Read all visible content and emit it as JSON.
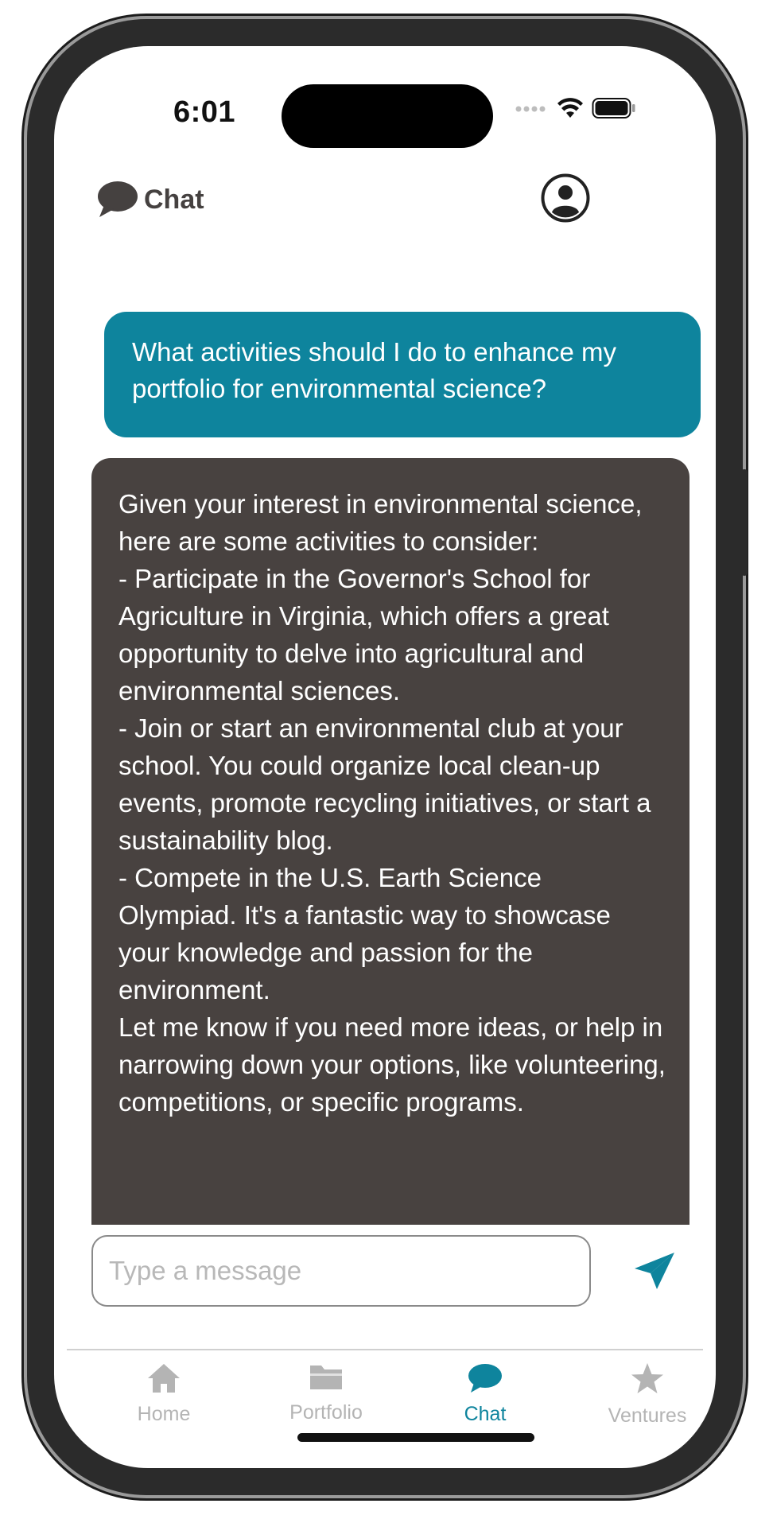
{
  "status_bar": {
    "time": "6:01"
  },
  "header": {
    "title": "Chat"
  },
  "messages": [
    {
      "role": "user",
      "text": "What activities should I do to enhance my portfolio for environmental science?"
    },
    {
      "role": "assistant",
      "text": "Given your interest in environmental science, here are some activities to consider:\n- Participate in the Governor's School for Agriculture in Virginia, which offers a great opportunity to delve into agricultural and environmental sciences.\n- Join or start an environmental club at your school. You could organize local clean-up events, promote recycling initiatives, or start a sustainability blog.\n- Compete in the U.S. Earth Science Olympiad. It's a fantastic way to showcase your knowledge and passion for the environment.\nLet me know if you need more ideas, or help in narrowing down your options, like volunteering, competitions, or specific programs."
    }
  ],
  "composer": {
    "placeholder": "Type a message",
    "value": ""
  },
  "tabs": [
    {
      "label": "Home",
      "icon": "house-icon",
      "active": false
    },
    {
      "label": "Portfolio",
      "icon": "folder-icon",
      "active": false
    },
    {
      "label": "Chat",
      "icon": "chat-bubble-icon",
      "active": true
    },
    {
      "label": "Ventures",
      "icon": "star-icon",
      "active": false
    }
  ],
  "colors": {
    "accent": "#0e849d",
    "user_bubble": "#0e849d",
    "assistant_bubble": "#484240",
    "header_text": "#454140",
    "inactive_tab": "#b4b4b4"
  }
}
